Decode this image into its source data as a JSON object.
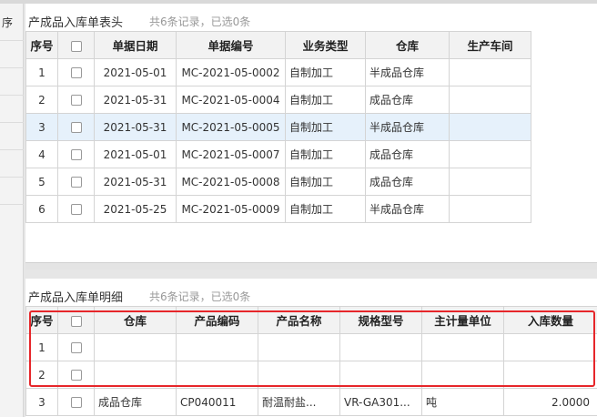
{
  "sidebar_fragment": "序",
  "header_panel": {
    "title": "产成品入库单表头",
    "info": "共6条记录，已选0条",
    "columns": [
      "序号",
      "",
      "单据日期",
      "单据编号",
      "业务类型",
      "仓库",
      "生产车间"
    ],
    "rows": [
      {
        "no": "1",
        "date": "2021-05-01",
        "code": "MC-2021-05-0002",
        "type": "自制加工",
        "warehouse": "半成品仓库",
        "workshop": ""
      },
      {
        "no": "2",
        "date": "2021-05-31",
        "code": "MC-2021-05-0004",
        "type": "自制加工",
        "warehouse": "成品仓库",
        "workshop": ""
      },
      {
        "no": "3",
        "date": "2021-05-31",
        "code": "MC-2021-05-0005",
        "type": "自制加工",
        "warehouse": "半成品仓库",
        "workshop": ""
      },
      {
        "no": "4",
        "date": "2021-05-01",
        "code": "MC-2021-05-0007",
        "type": "自制加工",
        "warehouse": "成品仓库",
        "workshop": ""
      },
      {
        "no": "5",
        "date": "2021-05-31",
        "code": "MC-2021-05-0008",
        "type": "自制加工",
        "warehouse": "成品仓库",
        "workshop": ""
      },
      {
        "no": "6",
        "date": "2021-05-25",
        "code": "MC-2021-05-0009",
        "type": "自制加工",
        "warehouse": "半成品仓库",
        "workshop": ""
      }
    ]
  },
  "detail_panel": {
    "title": "产成品入库单明细",
    "info": "共6条记录，已选0条",
    "columns": [
      "序号",
      "",
      "仓库",
      "产品编码",
      "产品名称",
      "规格型号",
      "主计量单位",
      "入库数量"
    ],
    "rows": [
      {
        "no": "1",
        "warehouse": "",
        "product_code": "",
        "product_name": "",
        "spec": "",
        "unit": "",
        "qty": ""
      },
      {
        "no": "2",
        "warehouse": "",
        "product_code": "",
        "product_name": "",
        "spec": "",
        "unit": "",
        "qty": ""
      },
      {
        "no": "3",
        "warehouse": "成品仓库",
        "product_code": "CP040011",
        "product_name": "耐温耐盐...",
        "spec": "VR-GA301...",
        "unit": "吨",
        "qty": "2.0000"
      }
    ]
  },
  "colors": {
    "highlight_border": "#e6262a",
    "selected_row": "#e6f1fb",
    "header_bg": "#f2f2f2"
  }
}
